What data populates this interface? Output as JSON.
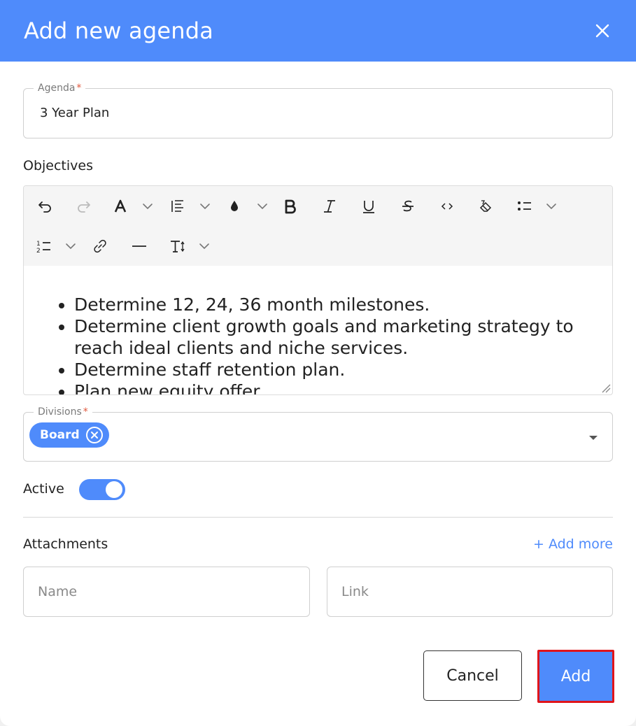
{
  "dialog": {
    "title": "Add new agenda",
    "close_icon": "close-icon"
  },
  "agenda": {
    "label": "Agenda",
    "required_mark": "*",
    "value": "3 Year Plan"
  },
  "objectives": {
    "label": "Objectives",
    "toolbar": [
      "undo-icon",
      "redo-icon",
      "font-color-icon",
      "line-height-icon",
      "highlight-icon",
      "bold-icon",
      "italic-icon",
      "underline-icon",
      "strikethrough-icon",
      "code-icon",
      "clear-format-icon",
      "bullet-list-icon",
      "numbered-list-icon",
      "link-icon",
      "horizontal-rule-icon",
      "font-size-icon"
    ],
    "items": [
      "Determine 12, 24, 36 month milestones.",
      "Determine client growth goals and marketing strategy to reach ideal clients and niche services.",
      "Determine staff retention plan.",
      "Plan new equity offer."
    ]
  },
  "divisions": {
    "label": "Divisions",
    "required_mark": "*",
    "chips": [
      "Board"
    ]
  },
  "active": {
    "label": "Active",
    "enabled": true
  },
  "attachments": {
    "label": "Attachments",
    "add_more": "+ Add more",
    "name_placeholder": "Name",
    "link_placeholder": "Link"
  },
  "footer": {
    "cancel_label": "Cancel",
    "add_label": "Add"
  },
  "colors": {
    "accent": "#4f8bfb",
    "required": "#e0573c",
    "highlight_border": "#e0141b"
  }
}
